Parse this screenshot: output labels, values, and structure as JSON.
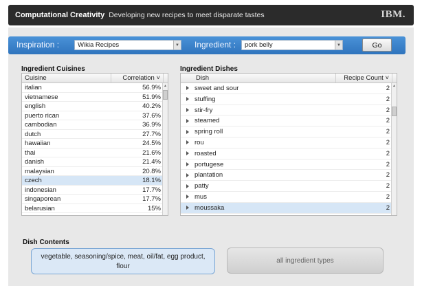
{
  "header": {
    "title": "Computational Creativity",
    "subtitle": "Developing new recipes to meet disparate tastes",
    "logo": "IBM."
  },
  "toolbar": {
    "inspiration_label": "Inspiration :",
    "inspiration_value": "Wikia Recipes",
    "ingredient_label": "Ingredient :",
    "ingredient_value": "pork belly",
    "go_label": "Go"
  },
  "cuisines": {
    "title": "Ingredient Cuisines",
    "col_cuisine": "Cuisine",
    "col_correlation": "Correlation ˅",
    "rows": [
      {
        "name": "italian",
        "value": "56.9%"
      },
      {
        "name": "vietnamese",
        "value": "51.9%"
      },
      {
        "name": "english",
        "value": "40.2%"
      },
      {
        "name": "puerto rican",
        "value": "37.6%"
      },
      {
        "name": "cambodian",
        "value": "36.9%"
      },
      {
        "name": "dutch",
        "value": "27.7%"
      },
      {
        "name": "hawaiian",
        "value": "24.5%"
      },
      {
        "name": "thai",
        "value": "21.6%"
      },
      {
        "name": "danish",
        "value": "21.4%"
      },
      {
        "name": "malaysian",
        "value": "20.8%"
      },
      {
        "name": "czech",
        "value": "18.1%"
      },
      {
        "name": "indonesian",
        "value": "17.7%"
      },
      {
        "name": "singaporean",
        "value": "17.7%"
      },
      {
        "name": "belarusian",
        "value": "15%"
      }
    ],
    "selected_index": 10
  },
  "dishes": {
    "title": "Ingredient Dishes",
    "col_dish": "Dish",
    "col_count": "Recipe Count ˅",
    "rows": [
      {
        "name": "sweet and sour",
        "count": "2"
      },
      {
        "name": "stuffing",
        "count": "2"
      },
      {
        "name": "stir-fry",
        "count": "2"
      },
      {
        "name": "steamed",
        "count": "2"
      },
      {
        "name": "spring roll",
        "count": "2"
      },
      {
        "name": "rou",
        "count": "2"
      },
      {
        "name": "roasted",
        "count": "2"
      },
      {
        "name": "portugese",
        "count": "2"
      },
      {
        "name": "plantation",
        "count": "2"
      },
      {
        "name": "patty",
        "count": "2"
      },
      {
        "name": "mus",
        "count": "2"
      },
      {
        "name": "moussaka",
        "count": "2"
      }
    ],
    "selected_index": 11
  },
  "dish_contents": {
    "title": "Dish Contents",
    "text": "vegetable, seasoning/spice, meat, oil/fat, egg product, flour",
    "all_types_label": "all ingredient types"
  },
  "colors": {
    "toolbar_blue": "#2f74bd",
    "selected_row": "#d6e6f6",
    "header_dark": "#2b2b2b"
  }
}
